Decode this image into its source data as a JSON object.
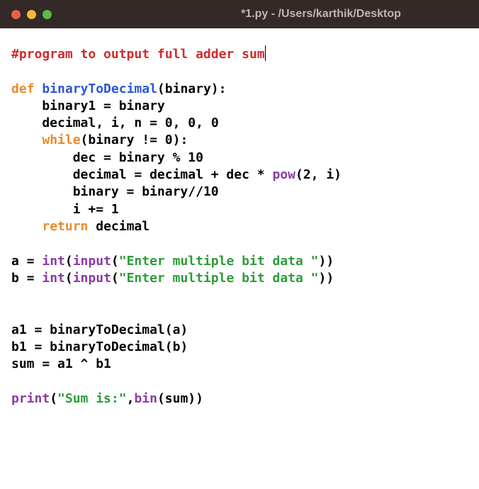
{
  "window": {
    "title": "*1.py - /Users/karthik/Desktop"
  },
  "code": {
    "comment": "#program to output full adder sum",
    "def_kw": "def",
    "func_name": "binaryToDecimal",
    "param": "binary",
    "line_assign1": "    binary1 = binary",
    "line_assign2a": "    decimal, i, n = ",
    "zero1": "0",
    "comma_sp": ", ",
    "zero2": "0",
    "zero3": "0",
    "while_kw": "while",
    "while_cond_a": "(binary != ",
    "while_zero": "0",
    "while_cond_b": "):",
    "dec_line_a": "        dec = binary % ",
    "ten1": "10",
    "decimal_line_a": "        decimal = decimal + dec * ",
    "pow_name": "pow",
    "pow_args": "(",
    "two": "2",
    "pow_tail": ", i)",
    "binary_line_a": "        binary = binary//",
    "ten2": "10",
    "incr_line_a": "        i += ",
    "one": "1",
    "return_kw": "return",
    "return_tail": " decimal",
    "a_eq": "a = ",
    "b_eq": "b = ",
    "int_name": "int",
    "input_name": "input",
    "lp": "(",
    "rp": ")",
    "prompt1": "\"Enter multiple bit data \"",
    "prompt2": "\"Enter multiple bit data \"",
    "a1_line": "a1 = binaryToDecimal(a)",
    "b1_line": "b1 = binaryToDecimal(b)",
    "sum_line": "sum = a1 ^ b1",
    "print_name": "print",
    "print_str": "\"Sum is:\"",
    "bin_name": "bin",
    "sum_ref": "sum",
    "comma": ","
  }
}
